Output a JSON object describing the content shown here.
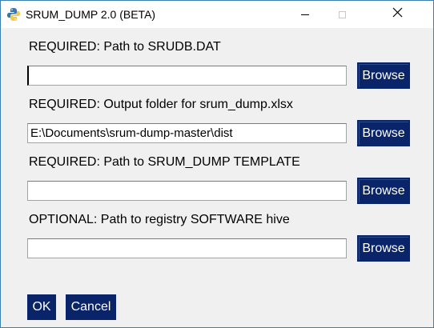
{
  "window": {
    "title": "SRUM_DUMP 2.0 (BETA)",
    "icon": "python-icon",
    "controls": [
      "minimize-icon",
      "maximize-icon",
      "close-icon"
    ]
  },
  "fields": [
    {
      "label": "REQUIRED: Path to SRUDB.DAT",
      "value": "",
      "browse_label": "Browse"
    },
    {
      "label": "REQUIRED: Output folder for srum_dump.xlsx",
      "value": "E:\\Documents\\srum-dump-master\\dist",
      "browse_label": "Browse"
    },
    {
      "label": "REQUIRED: Path to SRUM_DUMP TEMPLATE",
      "value": "",
      "browse_label": "Browse"
    },
    {
      "label": "OPTIONAL: Path to registry SOFTWARE hive",
      "value": "",
      "browse_label": "Browse"
    }
  ],
  "buttons": {
    "ok_label": "OK",
    "cancel_label": "Cancel"
  },
  "colors": {
    "button_bg": "#0a246a",
    "button_text": "#ffffff",
    "window_bg": "#f0f0f0",
    "window_border": "#3c7fb1"
  }
}
